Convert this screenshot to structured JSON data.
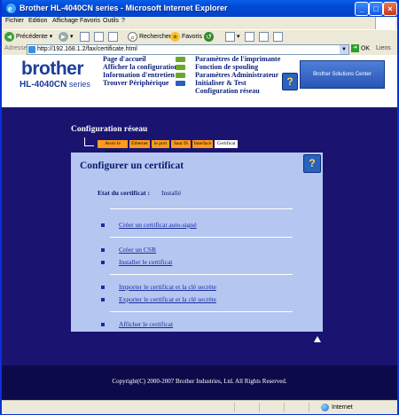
{
  "window": {
    "title": "Brother HL-4040CN series - Microsoft Internet Explorer"
  },
  "menu": [
    "Fichier",
    "Edition",
    "Affichage",
    "Favoris",
    "Outils",
    "?"
  ],
  "toolbar": {
    "back": "Précédente",
    "search": "Rechercher",
    "favorites": "Favoris"
  },
  "address": {
    "label": "Adresse",
    "url": "http://192.168.1.2/fax/certificate.html",
    "go": "OK",
    "links": "Liens"
  },
  "header": {
    "logo": "brother",
    "model_prefix": "HL-4040CN",
    "model_suffix": "series",
    "nav_left": [
      "Page d'accueil",
      "Afficher la configuration",
      "Information d'entretien",
      "Trouver Périphérique"
    ],
    "nav_right": [
      "Paramètres de l'imprimante",
      "Fonction de spouling",
      "Paramètres Administrateur",
      "Initialiser & Test",
      "Configuration réseau"
    ],
    "solutions_center": "Brother Solutions Center"
  },
  "section_title": "Configuration réseau",
  "tabs": [
    "Avoir le service",
    "Ethernet",
    "le port",
    "Saut IS",
    "Interface",
    "Certificat"
  ],
  "panel": {
    "title": "Configurer un certificat",
    "status_label": "Etat du certificat :",
    "status_value": "Installé",
    "links": [
      "Créer un certificat auto-signé",
      "Créer un CSR",
      "Installer le certificat",
      "Importer le certificat et la clé secrète",
      "Exporter le certificat et la clé secrète",
      "Afficher le certificat"
    ]
  },
  "footer": {
    "copyright": "Copyright(C) 2000-2007 Brother Industries, Ltd. All Rights Reserved."
  },
  "statusbar": {
    "zone": "Internet"
  }
}
